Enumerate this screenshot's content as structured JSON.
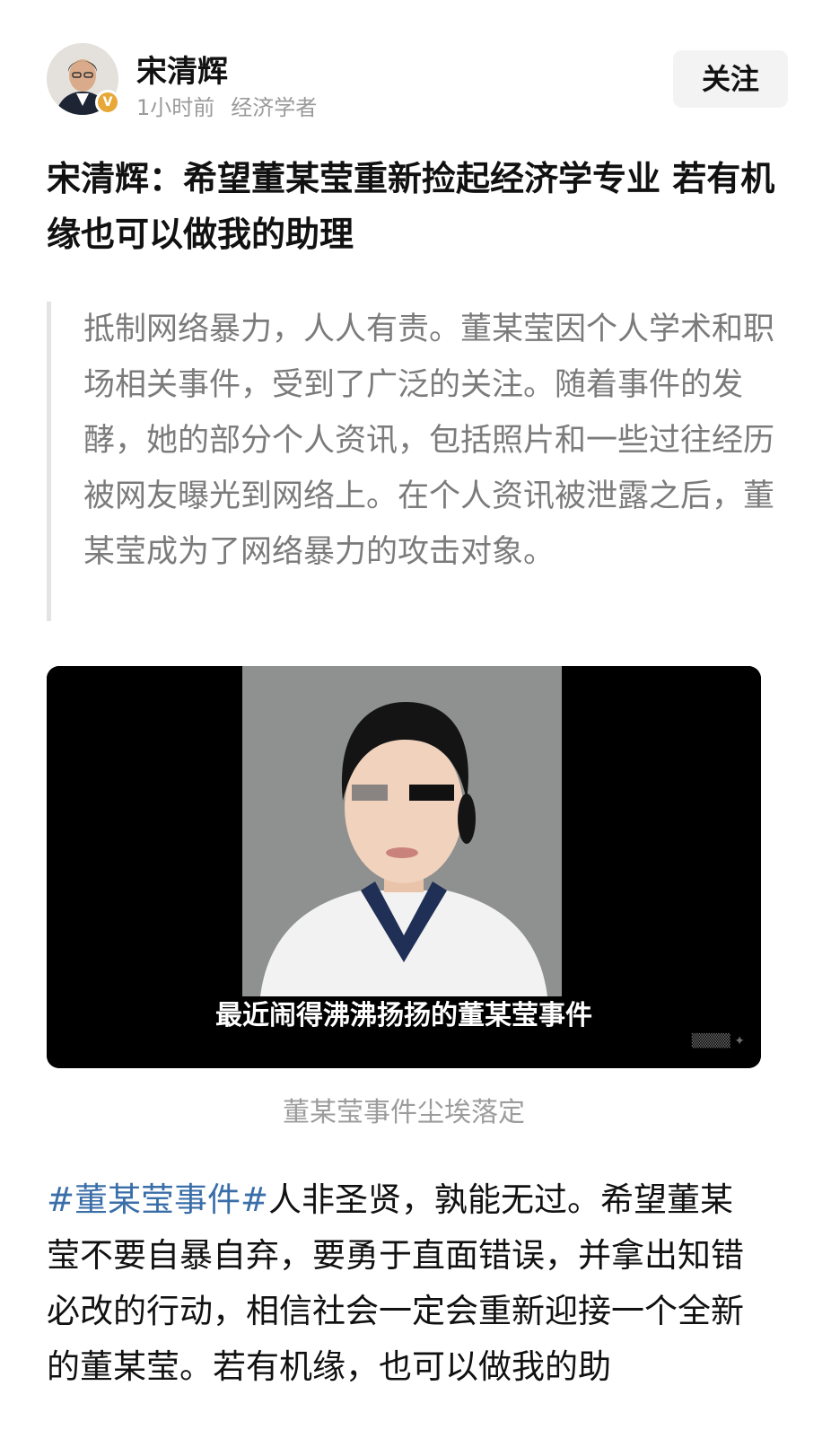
{
  "author": {
    "name": "宋清辉",
    "time": "1小时前",
    "role": "经济学者",
    "verified_badge": "V",
    "follow_label": "关注"
  },
  "article": {
    "title": "宋清辉：希望董某莹重新捡起经济学专业 若有机缘也可以做我的助理",
    "quote": "抵制网络暴力，人人有责。董某莹因个人学术和职场相关事件，受到了广泛的关注。随着事件的发酵，她的部分个人资讯，包括照片和一些过往经历被网友曝光到网络上。在个人资讯被泄露之后，董某莹成为了网络暴力的攻击对象。",
    "image_subtitle": "最近闹得沸沸扬扬的董某莹事件",
    "image_caption": "董某莹事件尘埃落定",
    "hashtag": "#董某莹事件#",
    "body": "人非圣贤，孰能无过。希望董某莹不要自暴自弃，要勇于直面错误，并拿出知错必改的行动，相信社会一定会重新迎接一个全新的董某莹。若有机缘，也可以做我的助"
  },
  "colors": {
    "hashtag": "#3a6ea8",
    "quote_text": "#7b7b7b",
    "badge": "#e8a838"
  }
}
